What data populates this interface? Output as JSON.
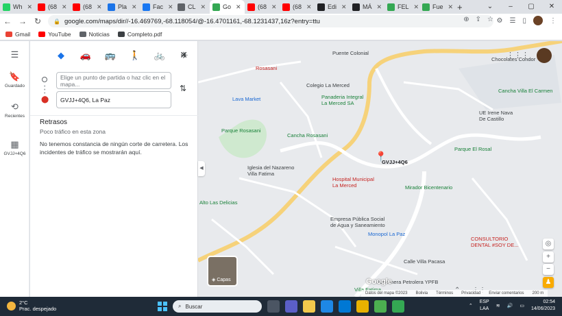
{
  "browser": {
    "tabs": [
      {
        "label": "Wh",
        "color": "#25d366"
      },
      {
        "label": "(68",
        "color": "#ff0000"
      },
      {
        "label": "(68",
        "color": "#ff0000"
      },
      {
        "label": "Pla",
        "color": "#1a73e8"
      },
      {
        "label": "Fac",
        "color": "#1877f2"
      },
      {
        "label": "CL",
        "color": "#5f6368"
      },
      {
        "label": "Go",
        "color": "#34a853",
        "active": true
      },
      {
        "label": "(68",
        "color": "#ff0000"
      },
      {
        "label": "(68",
        "color": "#ff0000"
      },
      {
        "label": "Edi",
        "color": "#202124"
      },
      {
        "label": "MÁ",
        "color": "#202124"
      },
      {
        "label": "FEL",
        "color": "#34a853"
      },
      {
        "label": "Fue",
        "color": "#34a853"
      }
    ],
    "new_tab": "+",
    "url": "google.com/maps/dir//-16.469769,-68.118054/@-16.4701161,-68.1231437,16z?entry=ttu",
    "bookmarks": [
      "Gmail",
      "YouTube",
      "Noticias",
      "Completo.pdf"
    ]
  },
  "rail": {
    "saved_label": "Guardado",
    "recent_label": "Recientes",
    "place_label": "GVJJ+4Q6"
  },
  "directions": {
    "start_placeholder": "Elige un punto de partida o haz clic en el mapa...",
    "destination_value": "GVJJ+4Q6, La Paz",
    "delays_title": "Retrasos",
    "delays_subtitle": "Poco tráfico en esta zona",
    "delays_text": "No tenemos constancia de ningún corte de carretera. Los incidentes de tráfico se mostrarán aquí."
  },
  "map": {
    "labels": {
      "puente_colonial": "Puente Colonial",
      "rosasani": "Rosasani",
      "colegio": "Colegio La Merced",
      "panaderia": "Panaderia Integral\nLa Merced SA",
      "lava_market": "Lava Market",
      "chocolates": "Chocolates Condor",
      "cancha_villa": "Cancha Villa El Carmen",
      "ue_irene": "UE Irene Nava\nDe Castillo",
      "parque_rosasani": "Parque Rosasani",
      "cancha_rosasani": "Cancha Rosasani",
      "pin_label": "GVJJ+4Q6",
      "parque_rosal": "Parque El Rosal",
      "iglesia": "Iglesia del Nazareno\nVilla Fatima",
      "hospital": "Hospital Municipal\nLa Merced",
      "mirador": "Mirador Bicentenario",
      "alto": "Alto Las Delicias",
      "empresa": "Empresa Pública Social\nde Agua y Saneamiento",
      "monopol": "Monopol La Paz",
      "consultorio": "CONSULTORIO\nDENTAL #SOY DE...",
      "calle_pacasa": "Calle Villa Pacasa",
      "gasolinera": "Gasolinera Petrolera YPFB",
      "villa_fatima": "Villa Fatima"
    },
    "layers_label": "Capas",
    "google": "Google",
    "footer": [
      "Datos del mapa ©2023",
      "Bolivia",
      "Términos",
      "Privacidad",
      "Enviar comentarios",
      "200 m"
    ]
  },
  "taskbar": {
    "temp": "2°C",
    "weather": "Prac. despejado",
    "search": "Buscar",
    "lang1": "ESP",
    "lang2": "LAA",
    "time": "02:54",
    "date": "14/06/2023"
  }
}
